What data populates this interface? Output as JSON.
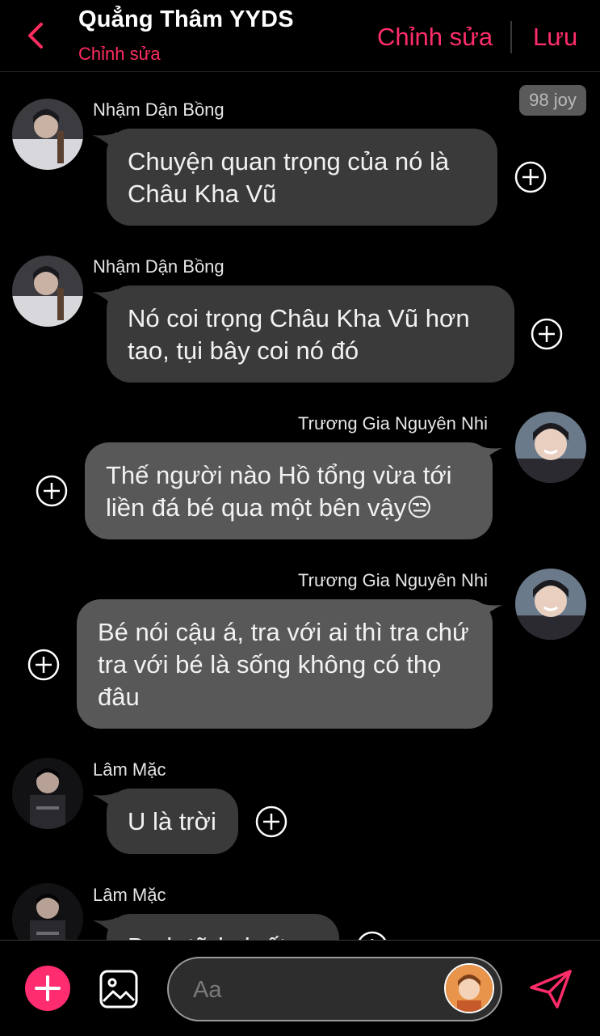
{
  "header": {
    "title": "Quẳng Thâm YYDS",
    "subtitle": "Chỉnh sửa",
    "edit_label": "Chỉnh sửa",
    "save_label": "Lưu"
  },
  "chat": {
    "joy_badge": "98 joy",
    "messages": [
      {
        "sender": "Nhậm Dận Bồng",
        "side": "left",
        "text": "Chuyện quan trọng của nó là Châu Kha Vũ"
      },
      {
        "sender": "Nhậm Dận Bồng",
        "side": "left",
        "text": "Nó coi trọng Châu Kha Vũ hơn tao, tụi bây coi nó đó"
      },
      {
        "sender": "Trương Gia Nguyên Nhi",
        "side": "right",
        "text": "Thế người nào Hồ tổng vừa tới liền đá bé qua một bên vậy😒"
      },
      {
        "sender": "Trương Gia Nguyên Nhi",
        "side": "right",
        "text": "Bé nói cậu á, tra với ai thì tra chứ tra với bé là sống không có thọ đâu"
      },
      {
        "sender": "Lâm Mặc",
        "side": "left",
        "text": "U là trời"
      },
      {
        "sender": "Lâm Mặc",
        "side": "left",
        "text": "Đ...h tữ l...h ất..."
      }
    ]
  },
  "composer": {
    "placeholder": "Aa"
  },
  "icons": {
    "back": "chevron-left-icon",
    "add": "plus-icon",
    "image": "image-icon",
    "send": "send-icon",
    "react": "add-circle-icon"
  },
  "colors": {
    "accent": "#ff2d6a",
    "bubble_left": "#3a3a3a",
    "bubble_right": "#585858"
  }
}
